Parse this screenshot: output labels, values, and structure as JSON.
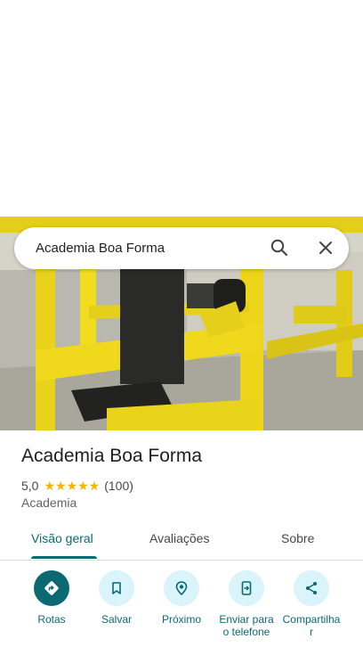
{
  "search": {
    "value": "Academia Boa Forma",
    "search_icon": "search-icon",
    "close_icon": "close-icon"
  },
  "place": {
    "name": "Academia Boa Forma",
    "rating": "5,0",
    "stars": "★★★★★",
    "review_count": "(100)",
    "category": "Academia"
  },
  "tabs": [
    {
      "label": "Visão geral",
      "active": true
    },
    {
      "label": "Avaliações",
      "active": false
    },
    {
      "label": "Sobre",
      "active": false
    }
  ],
  "actions": [
    {
      "label": "Rotas",
      "icon": "directions-icon"
    },
    {
      "label": "Salvar",
      "icon": "bookmark-icon"
    },
    {
      "label": "Próximo",
      "icon": "nearby-icon"
    },
    {
      "label": "Enviar para o telefone",
      "icon": "send-to-phone-icon"
    },
    {
      "label": "Compartilhar",
      "icon": "share-icon"
    }
  ],
  "colors": {
    "accent": "#0b6971",
    "action_bg": "#d9f4fb",
    "star": "#f4b400"
  }
}
